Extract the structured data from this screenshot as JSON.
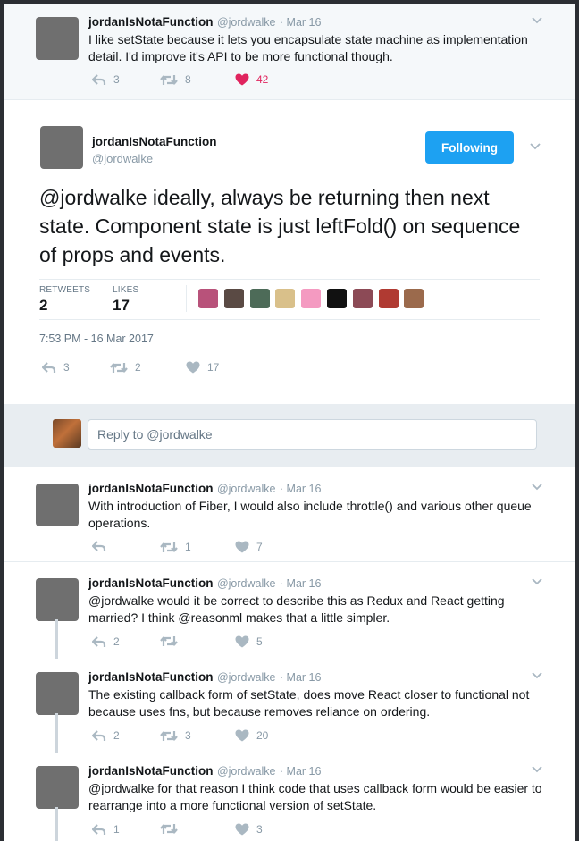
{
  "top_tweet": {
    "name": "jordanIsNotaFunction",
    "handle": "@jordwalke",
    "date": "· Mar 16",
    "text": "I like setState because it lets you encapsulate state machine as implementation detail. I'd improve it's API to be more functional though.",
    "replies": "3",
    "retweets": "8",
    "likes": "42"
  },
  "main_tweet": {
    "name": "jordanIsNotaFunction",
    "handle": "@jordwalke",
    "follow_label": "Following",
    "text": "@jordwalke ideally, always be returning then next state. Component state is just leftFold() on sequence of props and events.",
    "retweets_label": "RETWEETS",
    "retweets_value": "2",
    "likes_label": "LIKES",
    "likes_value": "17",
    "timestamp": "7:53 PM - 16 Mar 2017",
    "replies": "3",
    "retweets": "2",
    "likes": "17"
  },
  "liker_avatar_colors": [
    "#b8527a",
    "#5a4a44",
    "#4d6b58",
    "#d9c08a",
    "#f49ac1",
    "#111111",
    "#8c4a56",
    "#b03a32",
    "#9b6a4c"
  ],
  "reply_box": {
    "placeholder": "Reply to @jordwalke"
  },
  "replies": [
    {
      "name": "jordanIsNotaFunction",
      "handle": "@jordwalke",
      "date": "· Mar 16",
      "text": "With introduction of Fiber, I would also include throttle() and various other queue operations.",
      "replies": "",
      "retweets": "1",
      "likes": "7"
    },
    {
      "name": "jordanIsNotaFunction",
      "handle": "@jordwalke",
      "date": "· Mar 16",
      "text": "@jordwalke would it be correct to describe this as Redux and React getting married? I think @reasonml makes that a little simpler.",
      "replies": "2",
      "retweets": "",
      "likes": "5"
    },
    {
      "name": "jordanIsNotaFunction",
      "handle": "@jordwalke",
      "date": "· Mar 16",
      "text": "The existing callback form of setState, does move React closer to functional not because uses fns, but because removes reliance on ordering.",
      "replies": "2",
      "retweets": "3",
      "likes": "20"
    },
    {
      "name": "jordanIsNotaFunction",
      "handle": "@jordwalke",
      "date": "· Mar 16",
      "text": "@jordwalke for that reason I think code that uses callback form would be easier to rearrange into a more functional version of setState.",
      "replies": "1",
      "retweets": "",
      "likes": "3"
    }
  ],
  "colors": {
    "accent": "#1da1f2",
    "like": "#e0245e",
    "muted": "#8899a6"
  }
}
